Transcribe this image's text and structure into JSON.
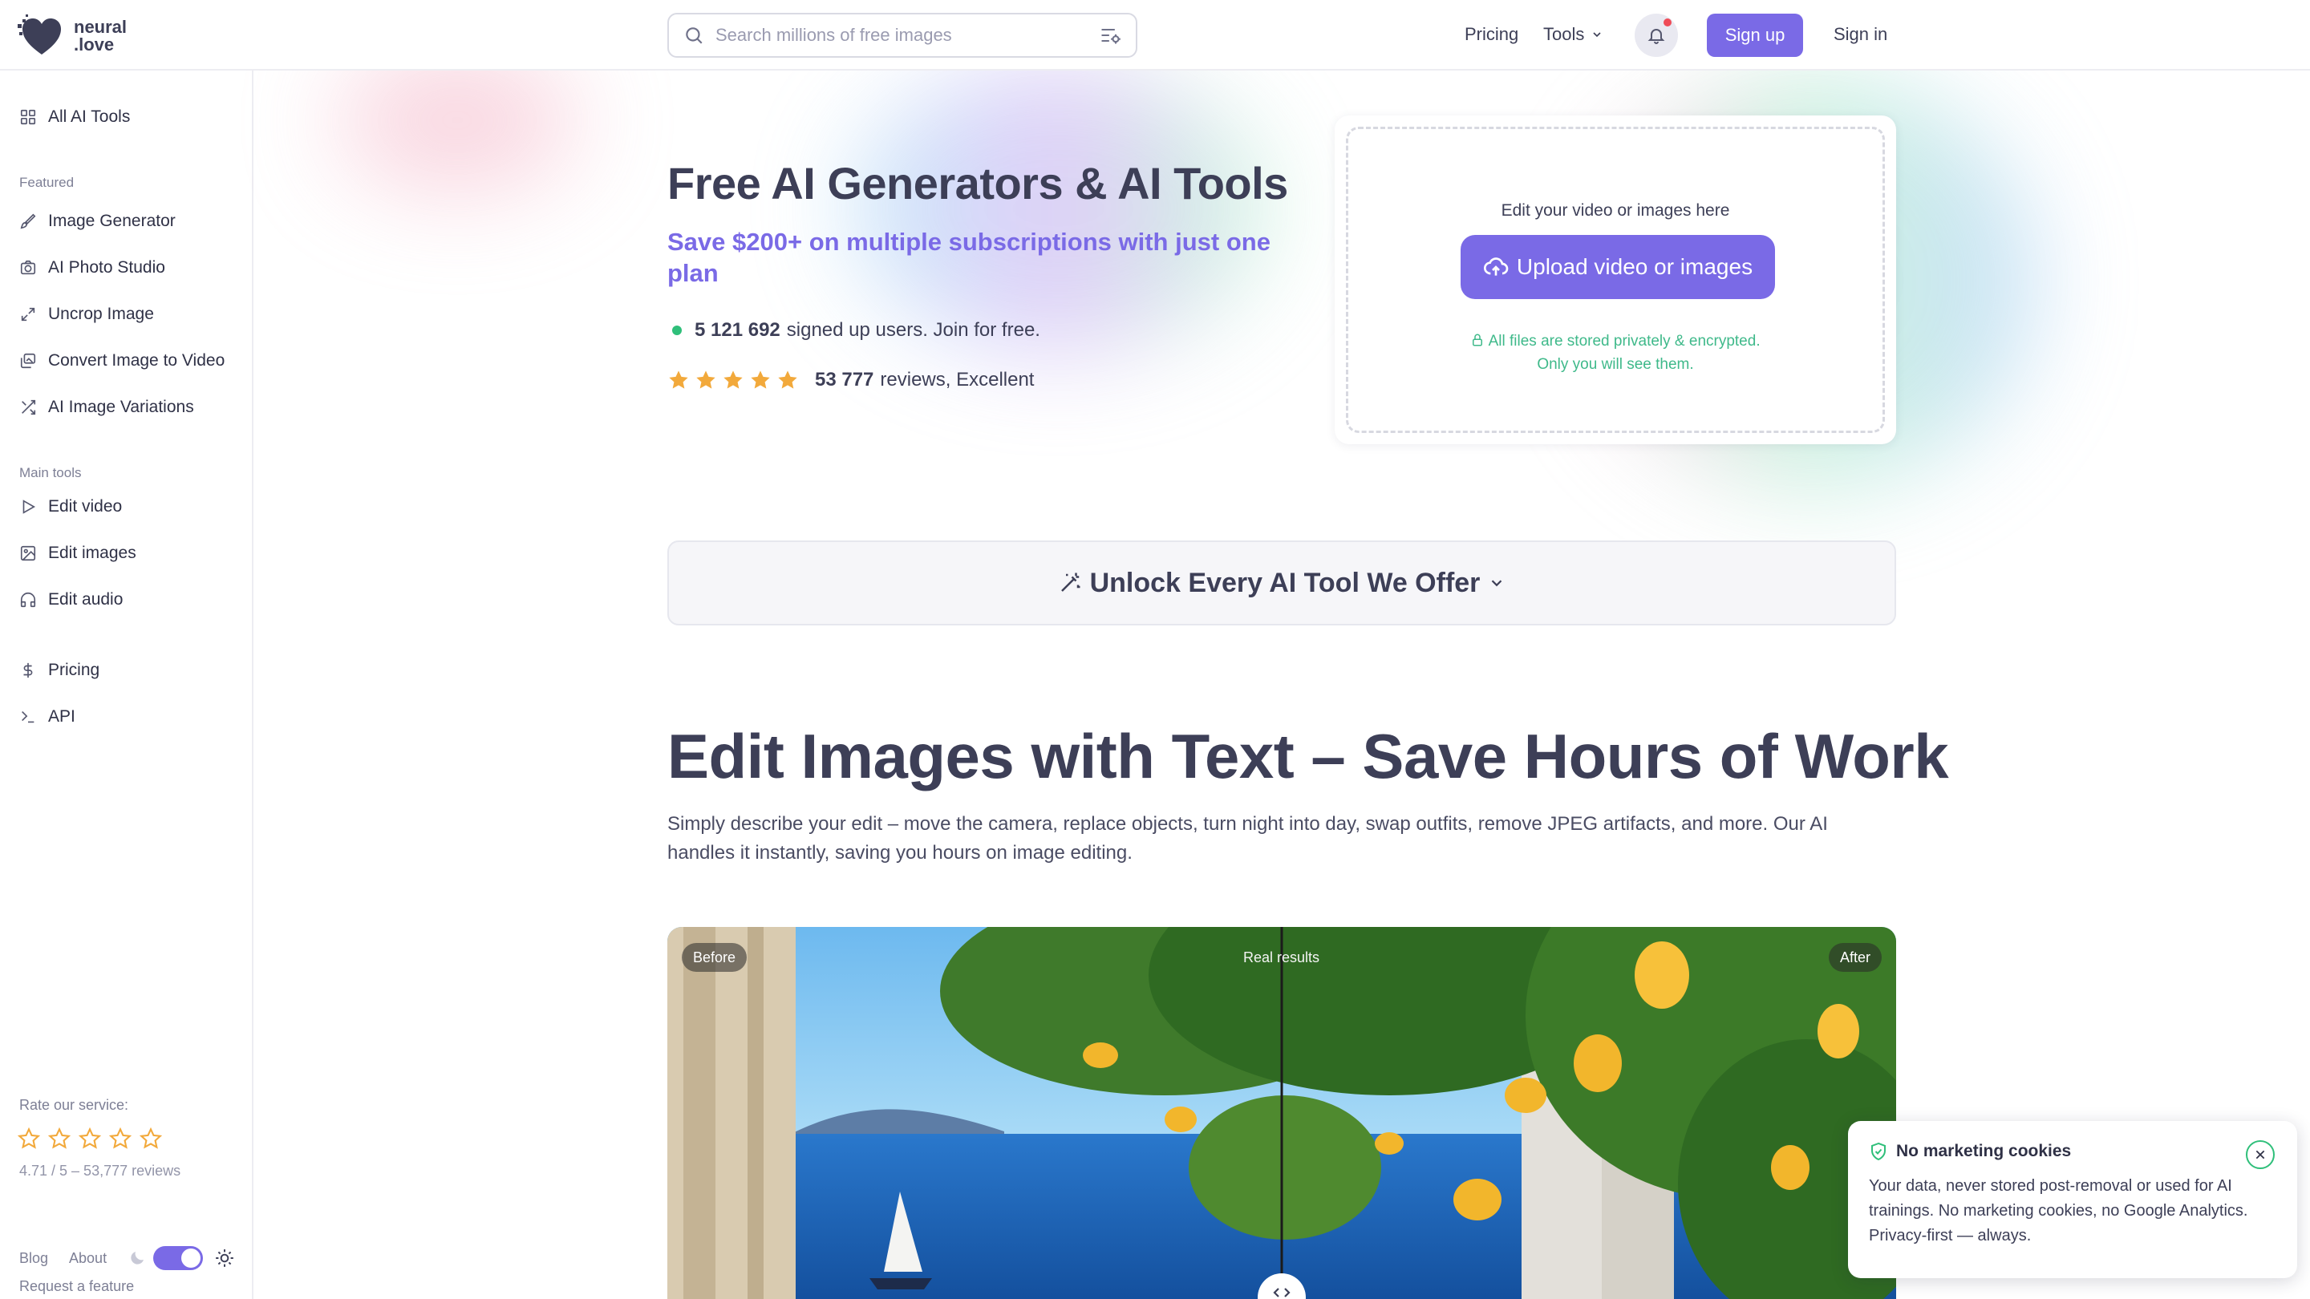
{
  "brand": {
    "name_line1": "neural",
    "name_line2": ".love"
  },
  "header": {
    "search_placeholder": "Search millions of free images",
    "nav_pricing": "Pricing",
    "nav_tools": "Tools",
    "signup": "Sign up",
    "signin": "Sign in"
  },
  "sidebar": {
    "all_tools": "All AI Tools",
    "featured_label": "Featured",
    "featured": [
      {
        "label": "Image Generator",
        "icon": "brush-icon"
      },
      {
        "label": "AI Photo Studio",
        "icon": "camera-icon"
      },
      {
        "label": "Uncrop Image",
        "icon": "expand-icon"
      },
      {
        "label": "Convert Image to Video",
        "icon": "images-icon"
      },
      {
        "label": "AI Image Variations",
        "icon": "shuffle-icon"
      }
    ],
    "main_label": "Main tools",
    "main": [
      {
        "label": "Edit video",
        "icon": "play-icon"
      },
      {
        "label": "Edit images",
        "icon": "image-icon"
      },
      {
        "label": "Edit audio",
        "icon": "headphones-icon"
      }
    ],
    "pricing": "Pricing",
    "api": "API",
    "rate_label": "Rate our service:",
    "rate_summary": "4.71 / 5 – 53,777 reviews",
    "footer": {
      "blog": "Blog",
      "about": "About",
      "request": "Request a feature"
    }
  },
  "hero": {
    "title": "Free AI Generators & AI Tools",
    "subtitle": "Save $200+ on multiple subscriptions with just one plan",
    "users_count": "5 121 692",
    "users_text": "signed up users. Join for free.",
    "reviews_count": "53 777",
    "reviews_text": "reviews, Excellent",
    "rating_stars": 5
  },
  "upload": {
    "hint": "Edit your video or images here",
    "button": "Upload video or images",
    "privacy_line1": "All files are stored privately & encrypted.",
    "privacy_line2": "Only you will see them."
  },
  "unlock": {
    "label": "Unlock Every AI Tool We Offer"
  },
  "section": {
    "title": "Edit Images with Text – Save Hours of Work",
    "description": "Simply describe your edit – move the camera, replace objects, turn night into day, swap outfits, remove JPEG artifacts, and more. Our AI handles it instantly, saving you hours on image editing."
  },
  "compare": {
    "before": "Before",
    "real": "Real results",
    "after": "After"
  },
  "cookie": {
    "title": "No marketing cookies",
    "body": "Your data, never stored post-removal or used for AI trainings. No marketing cookies, no Google Analytics. Privacy-first — always."
  },
  "colors": {
    "accent": "#7a6ae6",
    "green": "#2fbf7a",
    "star": "#f2a93b",
    "text": "#3d3f57"
  }
}
